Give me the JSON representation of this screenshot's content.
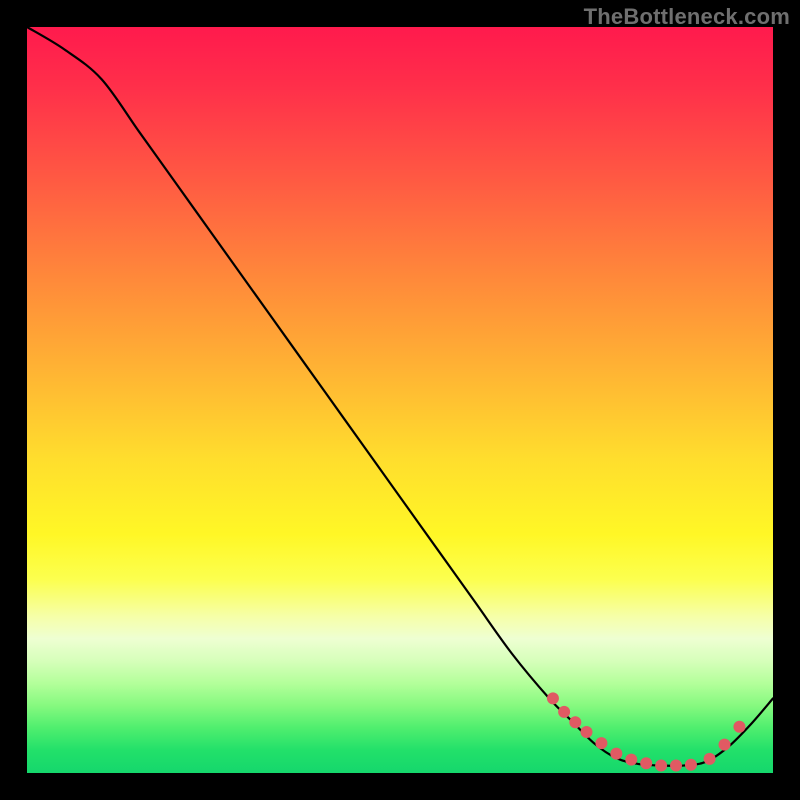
{
  "watermark": "TheBottleneck.com",
  "chart_data": {
    "type": "line",
    "title": "",
    "xlabel": "",
    "ylabel": "",
    "xlim": [
      0,
      100
    ],
    "ylim": [
      0,
      100
    ],
    "grid": false,
    "series": [
      {
        "name": "curve",
        "x": [
          0,
          5,
          10,
          15,
          20,
          25,
          30,
          35,
          40,
          45,
          50,
          55,
          60,
          65,
          70,
          73,
          76,
          79,
          82,
          85,
          88,
          91,
          94,
          97,
          100
        ],
        "y": [
          100,
          97,
          93,
          86,
          79,
          72,
          65,
          58,
          51,
          44,
          37,
          30,
          23,
          16,
          10,
          7,
          4,
          2,
          1.2,
          1,
          1,
          1.5,
          3.5,
          6.5,
          10
        ]
      }
    ],
    "markers": {
      "name": "highlight-dots",
      "color": "#e05a63",
      "x": [
        70.5,
        72.0,
        73.5,
        75.0,
        77.0,
        79.0,
        81.0,
        83.0,
        85.0,
        87.0,
        89.0,
        91.5,
        93.5,
        95.5
      ],
      "y": [
        10.0,
        8.2,
        6.8,
        5.5,
        4.0,
        2.6,
        1.8,
        1.3,
        1.0,
        1.0,
        1.1,
        1.9,
        3.8,
        6.2
      ]
    }
  }
}
